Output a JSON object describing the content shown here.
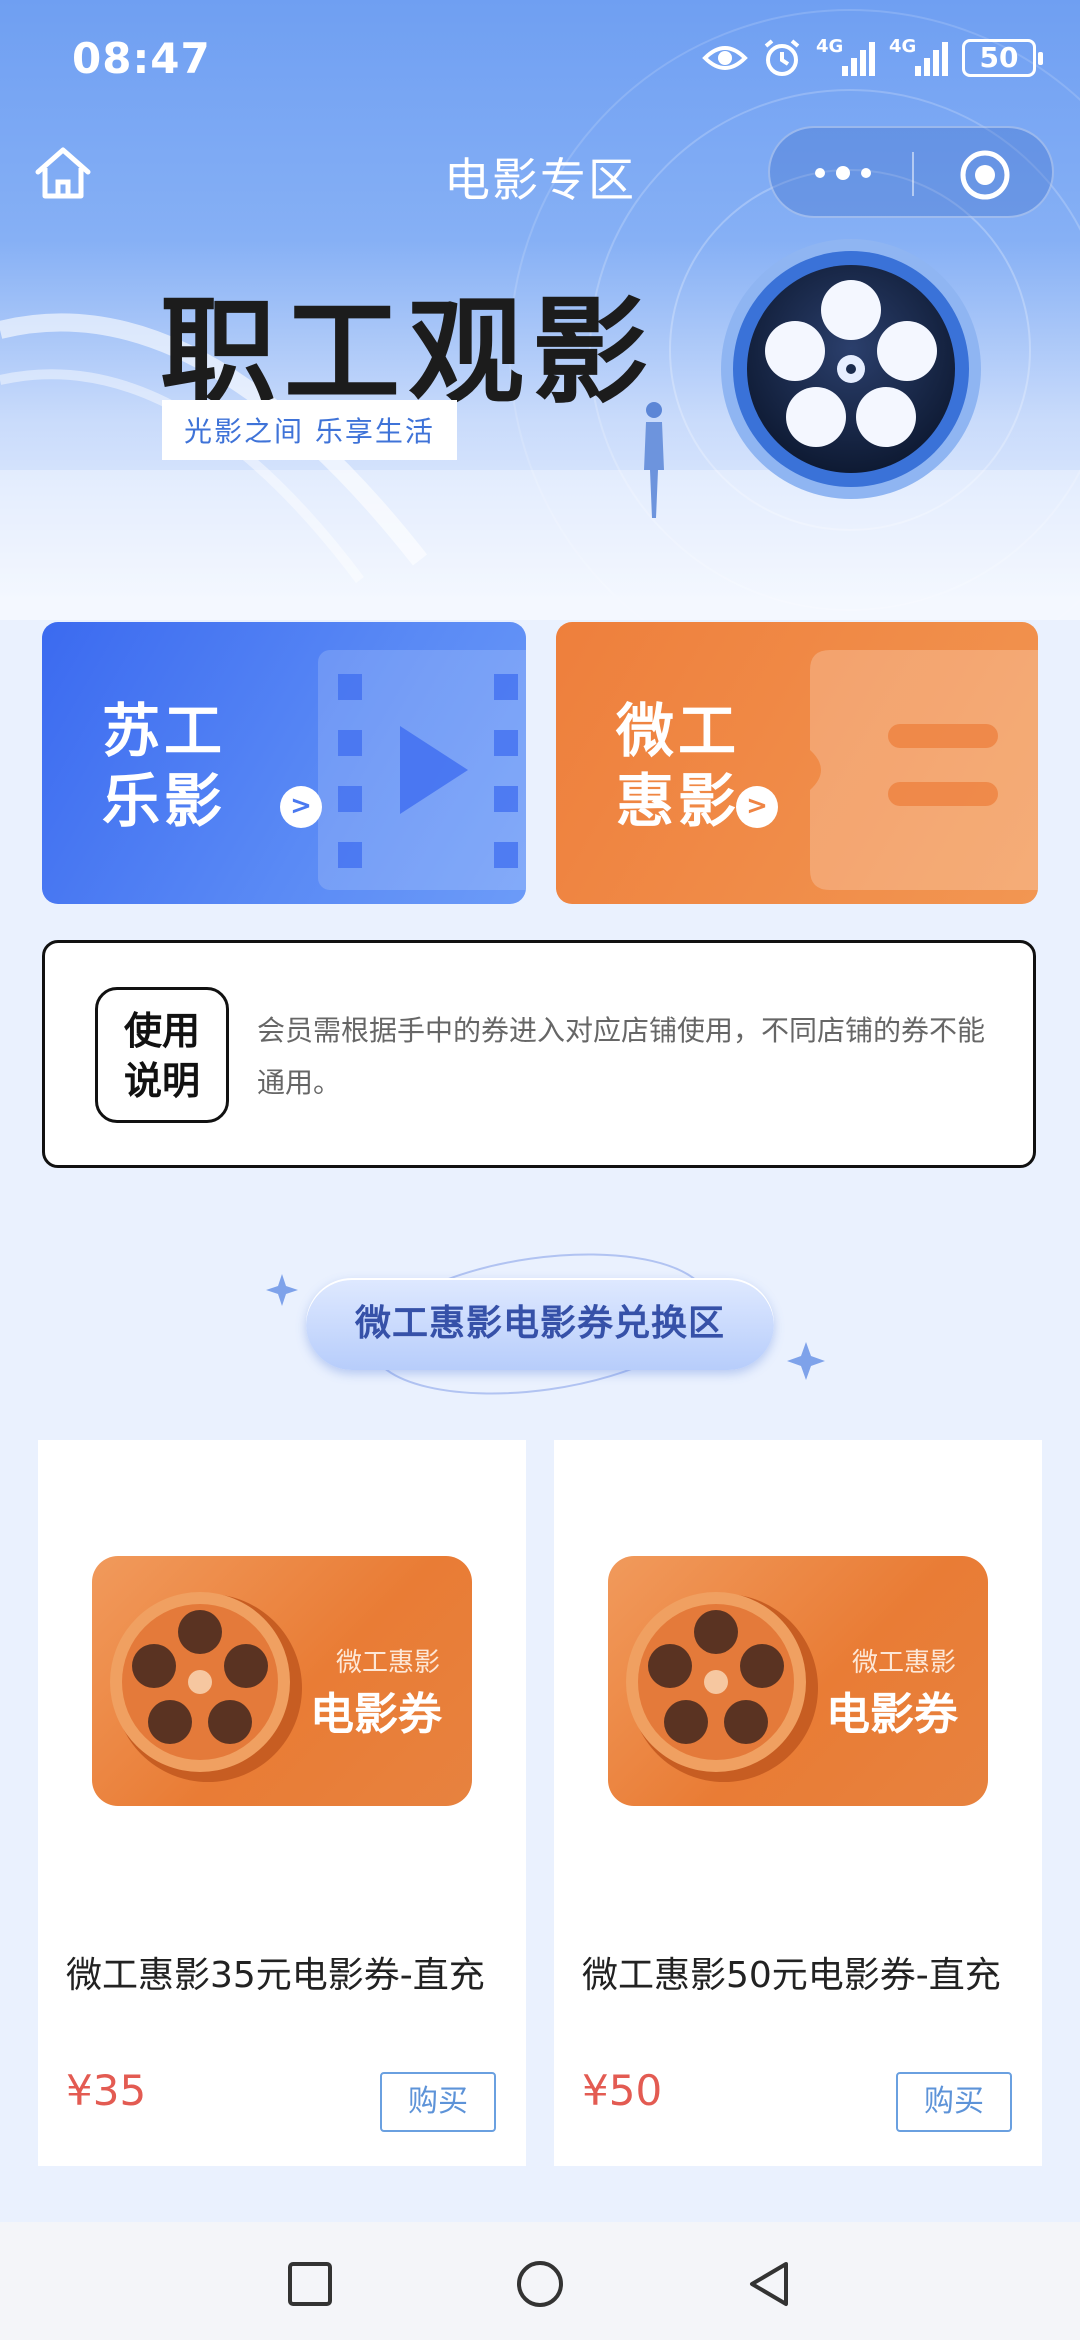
{
  "status": {
    "time": "08:47",
    "net1": "4G",
    "net2": "4G",
    "battery": "50"
  },
  "navbar": {
    "title": "电影专区"
  },
  "banner": {
    "title": "职工观影",
    "subtitle": "光影之间 乐享生活"
  },
  "entries": [
    {
      "line1": "苏工",
      "line2": "乐影",
      "arrow": ">"
    },
    {
      "line1": "微工",
      "line2": "惠影",
      "arrow": ">"
    }
  ],
  "notice": {
    "badge_line1": "使用",
    "badge_line2": "说明",
    "text": "会员需根据手中的券进入对应店铺使用，不同店铺的券不能通用。"
  },
  "section": {
    "title": "微工惠影电影券兑换区"
  },
  "products": [
    {
      "img_line1": "微工惠影",
      "img_line2": "电影券",
      "name": "微工惠影35元电影券-直充",
      "price": "¥35",
      "buy": "购买"
    },
    {
      "img_line1": "微工惠影",
      "img_line2": "电影券",
      "name": "微工惠影50元电影券-直充",
      "price": "¥50",
      "buy": "购买"
    }
  ],
  "colors": {
    "blue_card": "#3b6af0",
    "orange_card": "#ee7f3c",
    "price": "#e35b52",
    "buy_border": "#6aa0e0"
  },
  "icons": [
    "eye-icon",
    "alarm-icon",
    "signal-icon",
    "battery-icon",
    "home-icon",
    "more-icon",
    "target-icon",
    "film-reel-icon",
    "square-icon",
    "circle-icon",
    "back-triangle-icon"
  ]
}
